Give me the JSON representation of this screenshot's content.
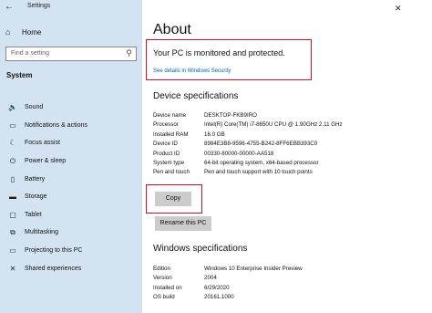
{
  "window": {
    "title": "Settings",
    "close_glyph": "✕"
  },
  "sidebar": {
    "home_label": "Home",
    "search_placeholder": "Find a setting",
    "section_label": "System",
    "items": [
      {
        "label": "Sound",
        "icon": "sound-icon"
      },
      {
        "label": "Notifications & actions",
        "icon": "notifications-icon"
      },
      {
        "label": "Focus assist",
        "icon": "focus-assist-icon"
      },
      {
        "label": "Power & sleep",
        "icon": "power-icon"
      },
      {
        "label": "Battery",
        "icon": "battery-icon"
      },
      {
        "label": "Storage",
        "icon": "storage-icon"
      },
      {
        "label": "Tablet",
        "icon": "tablet-icon"
      },
      {
        "label": "Multitasking",
        "icon": "multitasking-icon"
      },
      {
        "label": "Projecting to this PC",
        "icon": "projecting-icon"
      },
      {
        "label": "Shared experiences",
        "icon": "shared-experiences-icon"
      }
    ]
  },
  "main": {
    "page_title": "About",
    "protection_text": "Your PC is monitored and protected.",
    "security_link": "See details in Windows Security",
    "device_heading": "Device specifications",
    "device_specs": [
      {
        "label": "Device name",
        "value": "DESKTOP-FKB9IRO"
      },
      {
        "label": "Processor",
        "value": "Intel(R) Core(TM) i7-8650U CPU @ 1.90GHz   2.11 GHz"
      },
      {
        "label": "Installed RAM",
        "value": "16.0 GB"
      },
      {
        "label": "Device ID",
        "value": "8984E3B8-9596-4755-B242-8FF6EBB393C0"
      },
      {
        "label": "Product ID",
        "value": "00330-80000-00000-AA518"
      },
      {
        "label": "System type",
        "value": "64-bit operating system, x64-based processor"
      },
      {
        "label": "Pen and touch",
        "value": "Pen and touch support with 10 touch points"
      }
    ],
    "copy_label": "Copy",
    "rename_label": "Rename this PC",
    "windows_heading": "Windows specifications",
    "windows_specs": [
      {
        "label": "Edition",
        "value": "Windows 10 Enterprise Insider Preview"
      },
      {
        "label": "Version",
        "value": "2004"
      },
      {
        "label": "Installed on",
        "value": "6/29/2020"
      },
      {
        "label": "OS build",
        "value": "20161.1000"
      }
    ]
  },
  "colors": {
    "sidebar_bg": "#d3e3f1",
    "link": "#0066b4",
    "highlight_border": "#d0102b",
    "button_bg": "#cccccc"
  }
}
